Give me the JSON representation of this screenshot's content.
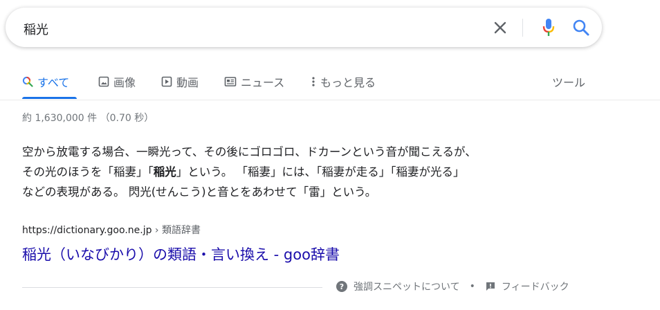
{
  "search": {
    "query": "稲光",
    "icons": [
      "close-icon",
      "microphone-icon",
      "search-icon"
    ]
  },
  "tabs": [
    {
      "label": "すべて",
      "icon": "search-icon",
      "active": true
    },
    {
      "label": "画像",
      "icon": "image-icon",
      "active": false
    },
    {
      "label": "動画",
      "icon": "video-icon",
      "active": false
    },
    {
      "label": "ニュース",
      "icon": "news-icon",
      "active": false
    },
    {
      "label": "もっと見る",
      "icon": "more-vert-icon",
      "active": false
    }
  ],
  "tools_label": "ツール",
  "result_stats": "約 1,630,000 件 （0.70 秒）",
  "snippet": {
    "line1": "空から放電する場合、一瞬光って、その後にゴロゴロ、ドカーンという音が聞こえるが、",
    "line2_a": "その光のほうを「稲妻」「",
    "line2_bold": "稲光",
    "line2_b": "」という。 「稲妻」には、「稲妻が走る」「稲妻が光る」",
    "line3": "などの表現がある。 閃光(せんこう)と音とをあわせて「雷」という。"
  },
  "result": {
    "url": "https://dictionary.goo.ne.jp",
    "breadcrumb": " › 類語辞書",
    "title": "稲光（いなびかり）の類語・言い換え - goo辞書"
  },
  "footer": {
    "about_label": "強調スニペットについて",
    "separator": "•",
    "feedback_label": "フィードバック"
  },
  "colors": {
    "accent": "#1a73e8",
    "link": "#1a0dab",
    "mic_blue": "#4285f4",
    "mic_red": "#ea4335",
    "mic_yellow": "#fbbc04",
    "mic_green": "#34a853"
  }
}
